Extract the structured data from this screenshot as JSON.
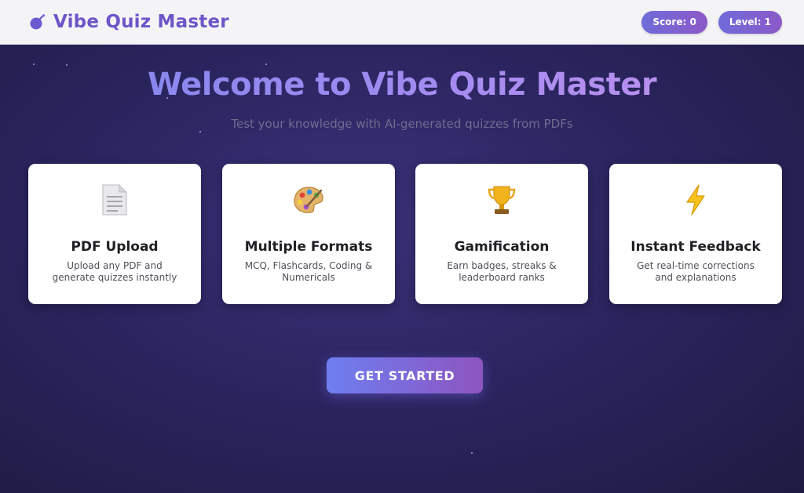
{
  "header": {
    "brand_title": "Vibe Quiz Master",
    "logo_icon": "bomb-icon",
    "score_label": "Score: 0",
    "level_label": "Level: 1"
  },
  "hero": {
    "title": "Welcome to Vibe Quiz Master",
    "subtitle": "Test your knowledge with AI-generated quizzes from PDFs"
  },
  "features": [
    {
      "icon": "document-icon",
      "title": "PDF Upload",
      "description": "Upload any PDF and generate quizzes instantly"
    },
    {
      "icon": "artist-palette-icon",
      "title": "Multiple Formats",
      "description": "MCQ, Flashcards, Coding & Numericals"
    },
    {
      "icon": "trophy-icon",
      "title": "Gamification",
      "description": "Earn badges, streaks & leaderboard ranks"
    },
    {
      "icon": "lightning-icon",
      "title": "Instant Feedback",
      "description": "Get real-time corrections and explanations"
    }
  ],
  "cta": {
    "label": "GET STARTED"
  },
  "colors": {
    "accent": "#6d55c9",
    "background": "#2b2560",
    "card": "#ffffff",
    "button_gradient_start": "#6e7ff0",
    "button_gradient_end": "#8e55c0"
  }
}
